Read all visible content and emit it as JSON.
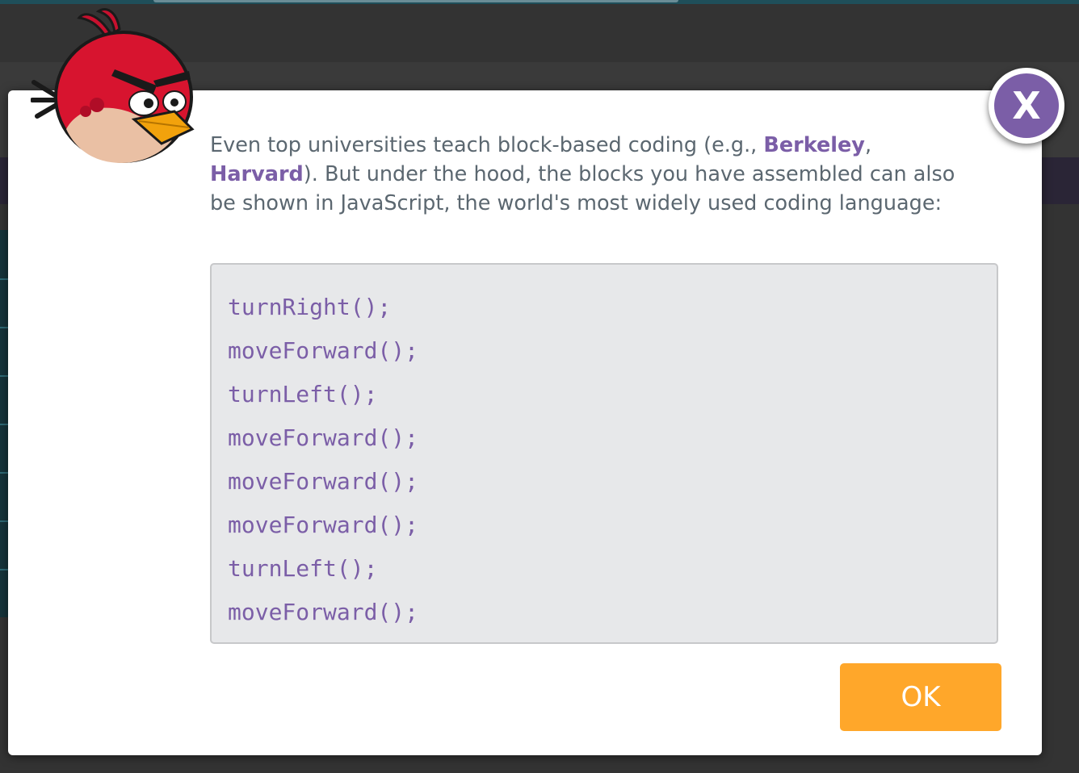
{
  "dialog": {
    "message": {
      "part1": "Even top universities teach block-based coding (e.g., ",
      "link1": "Berkeley",
      "part2": ", ",
      "link2": "Harvard",
      "part3": "). But under the hood, the blocks you have assembled can also be shown in JavaScript, the world's most widely used coding language:"
    },
    "code_lines": [
      "turnRight();",
      "moveForward();",
      "turnLeft();",
      "moveForward();",
      "moveForward();",
      "moveForward();",
      "turnLeft();",
      "moveForward();"
    ],
    "ok_label": "OK",
    "close_label": "X"
  },
  "colors": {
    "accent_purple": "#7b5ea7",
    "ok_orange": "#ffa72a",
    "text_gray": "#5b6770",
    "code_bg": "#e7e8ea"
  },
  "icons": {
    "avatar": "red-bird-icon",
    "close": "close-icon"
  }
}
